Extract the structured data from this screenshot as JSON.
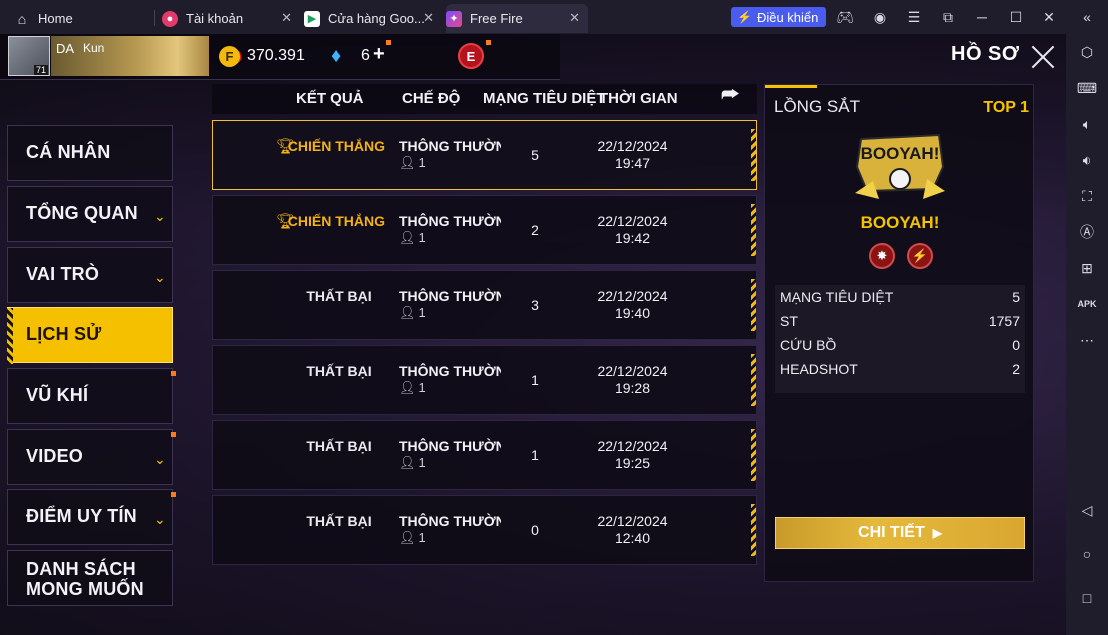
{
  "browser": {
    "tabs": [
      {
        "label": "Home",
        "icon": "home-icon"
      },
      {
        "label": "Tài khoản",
        "icon": "account-icon"
      },
      {
        "label": "Cửa hàng Goo...",
        "icon": "play-store-icon"
      },
      {
        "label": "Free Fire",
        "icon": "free-fire-icon"
      }
    ],
    "control_button": "Điều khiển"
  },
  "profile": {
    "name": "DA",
    "name_suffix": "Kun",
    "level": "71",
    "coins": "370.391",
    "diamonds": "6",
    "elite_badge": "E"
  },
  "header": {
    "title": "HỒ SƠ"
  },
  "menu": [
    {
      "label": "CÁ NHÂN",
      "has_chevron": false
    },
    {
      "label": "TỔNG QUAN",
      "has_chevron": true
    },
    {
      "label": "VAI TRÒ",
      "has_chevron": true
    },
    {
      "label": "LỊCH SỬ",
      "has_chevron": false,
      "active": true
    },
    {
      "label": "VŨ KHÍ",
      "has_chevron": false
    },
    {
      "label": "VIDEO",
      "has_chevron": true
    },
    {
      "label": "ĐIỂM UY TÍN",
      "has_chevron": true
    },
    {
      "label_line1": "DANH SÁCH",
      "label_line2": "MONG MUỐN",
      "has_chevron": false
    }
  ],
  "history": {
    "columns": [
      "KẾT QUẢ",
      "CHẾ ĐỘ",
      "MẠNG TIÊU DIỆT",
      "THỜI GIAN"
    ],
    "rows": [
      {
        "result": "CHIẾN THẮNG",
        "win": true,
        "mode": "THÔNG THƯỜNG",
        "players": "1",
        "kills": "5",
        "date": "22/12/2024",
        "time": "19:47",
        "selected": true
      },
      {
        "result": "CHIẾN THẮNG",
        "win": true,
        "mode": "THÔNG THƯỜNG",
        "players": "1",
        "kills": "2",
        "date": "22/12/2024",
        "time": "19:42"
      },
      {
        "result": "THẤT BẠI",
        "win": false,
        "mode": "THÔNG THƯỜNG",
        "players": "1",
        "kills": "3",
        "date": "22/12/2024",
        "time": "19:40"
      },
      {
        "result": "THẤT BẠI",
        "win": false,
        "mode": "THÔNG THƯỜNG",
        "players": "1",
        "kills": "1",
        "date": "22/12/2024",
        "time": "19:28"
      },
      {
        "result": "THẤT BẠI",
        "win": false,
        "mode": "THÔNG THƯỜNG",
        "players": "1",
        "kills": "1",
        "date": "22/12/2024",
        "time": "19:25"
      },
      {
        "result": "THẤT BẠI",
        "win": false,
        "mode": "THÔNG THƯỜNG",
        "players": "1",
        "kills": "0",
        "date": "22/12/2024",
        "time": "12:40"
      }
    ]
  },
  "detail": {
    "map": "LỒNG SẮT",
    "rank": "TOP 1",
    "banner_text": "BOOYAH!",
    "result_label": "BOOYAH!",
    "stats": [
      {
        "label": "MẠNG TIÊU DIỆT",
        "value": "5"
      },
      {
        "label": "ST",
        "value": "1757"
      },
      {
        "label": "CỨU BỒ",
        "value": "0"
      },
      {
        "label": "HEADSHOT",
        "value": "2"
      }
    ],
    "button": "CHI TIẾT"
  },
  "colors": {
    "accent": "#f5c000",
    "win": "#f4b214",
    "panel": "#0e0b16"
  }
}
